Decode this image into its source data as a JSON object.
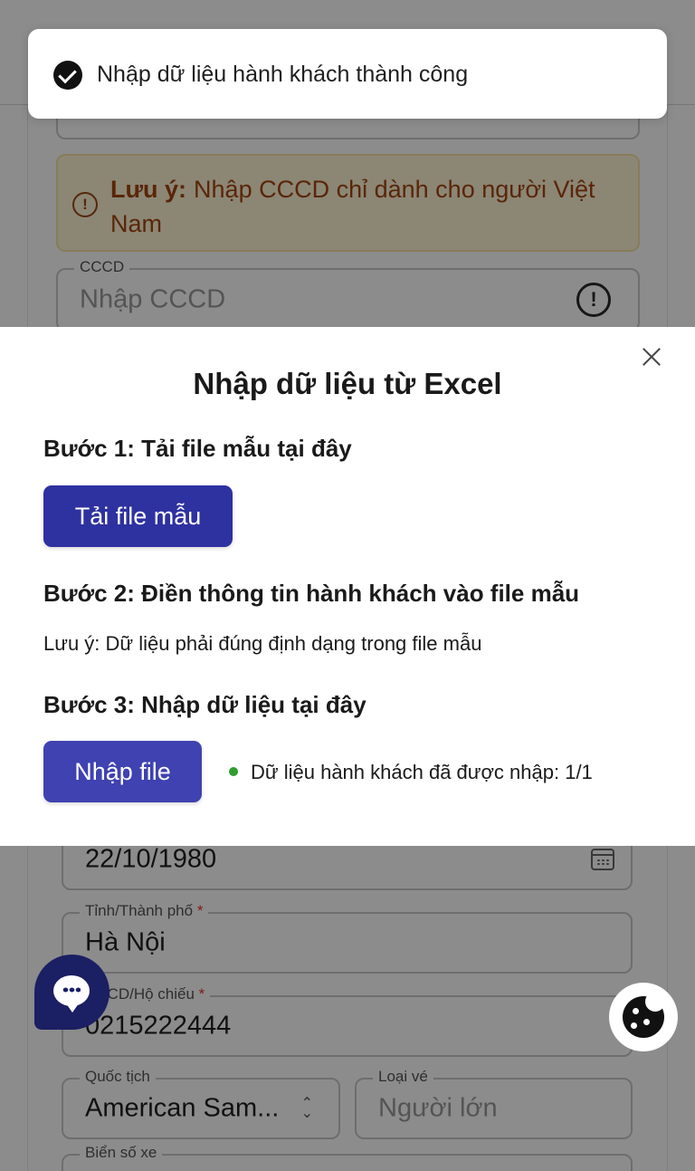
{
  "toast": {
    "message": "Nhập dữ liệu hành khách thành công"
  },
  "background": {
    "notice": {
      "label": "Lưu ý:",
      "text": "Nhập CCCD chỉ dành cho người Việt Nam"
    },
    "cccd": {
      "label": "CCCD",
      "placeholder": "Nhập CCCD"
    },
    "birth_date": {
      "value": "22/10/1980"
    },
    "province": {
      "label": "Tỉnh/Thành phố",
      "value": "Hà Nội"
    },
    "id_passport": {
      "label": "CCCD/Hộ chiếu",
      "value": "0215222444"
    },
    "nationality": {
      "label": "Quốc tịch",
      "value": "American Sam..."
    },
    "ticket_type": {
      "label": "Loại vé",
      "value": "Người lớn"
    },
    "plate": {
      "label": "Biển số xe"
    },
    "required_mark": "*"
  },
  "modal": {
    "title": "Nhập dữ liệu từ Excel",
    "step1_title": "Bước 1: Tải file mẫu tại đây",
    "download_button": "Tải file mẫu",
    "step2_title": "Bước 2: Điền thông tin hành khách vào file mẫu",
    "step2_note": "Lưu ý: Dữ liệu phải đúng định dạng trong file mẫu",
    "step3_title": "Bước 3: Nhập dữ liệu tại đây",
    "import_button": "Nhập file",
    "import_status": "Dữ liệu hành khách đã được nhập: 1/1"
  },
  "colors": {
    "primary": "#2e31a0",
    "status_dot": "#2e9e2e",
    "notice_bg": "#fff5d6",
    "notice_text": "#a3460e",
    "chat_btn": "#1b1f63"
  },
  "icons": {
    "toast": "check-circle-icon",
    "notice": "warning-icon",
    "cccd": "info-circle-icon",
    "birth_date": "calendar-icon",
    "nationality": "select-arrows-icon",
    "close": "close-icon",
    "chat": "chat-bubble-icon",
    "cookie": "cookie-icon"
  }
}
